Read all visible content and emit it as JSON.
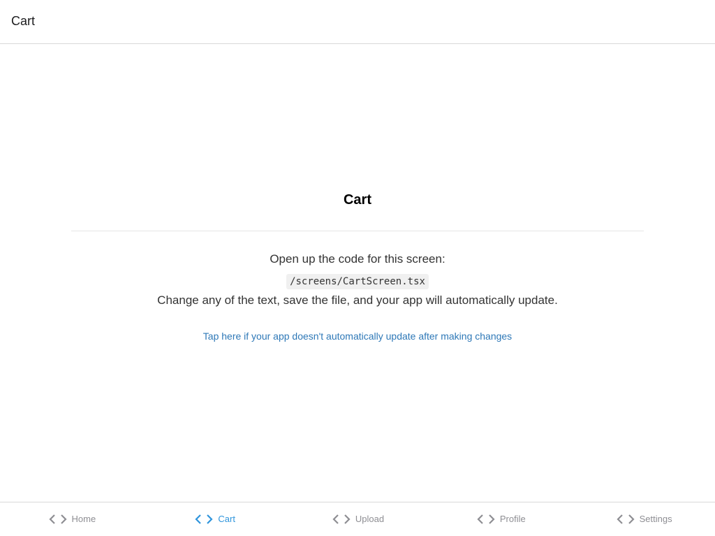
{
  "header": {
    "title": "Cart"
  },
  "screen": {
    "title": "Cart",
    "intro": "Open up the code for this screen:",
    "path": "/screens/CartScreen.tsx",
    "change_text": "Change any of the text, save the file, and your app will automatically update.",
    "help_link": "Tap here if your app doesn't automatically update after making changes"
  },
  "tabs": [
    {
      "label": "Home",
      "icon": "code-icon",
      "active": false
    },
    {
      "label": "Cart",
      "icon": "code-icon",
      "active": true
    },
    {
      "label": "Upload",
      "icon": "code-icon",
      "active": false
    },
    {
      "label": "Profile",
      "icon": "code-icon",
      "active": false
    },
    {
      "label": "Settings",
      "icon": "code-icon",
      "active": false
    }
  ],
  "colors": {
    "tab_active": "#2f95dc",
    "tab_inactive": "#8e8e93",
    "link": "#2e78b7",
    "text": "#333333"
  }
}
